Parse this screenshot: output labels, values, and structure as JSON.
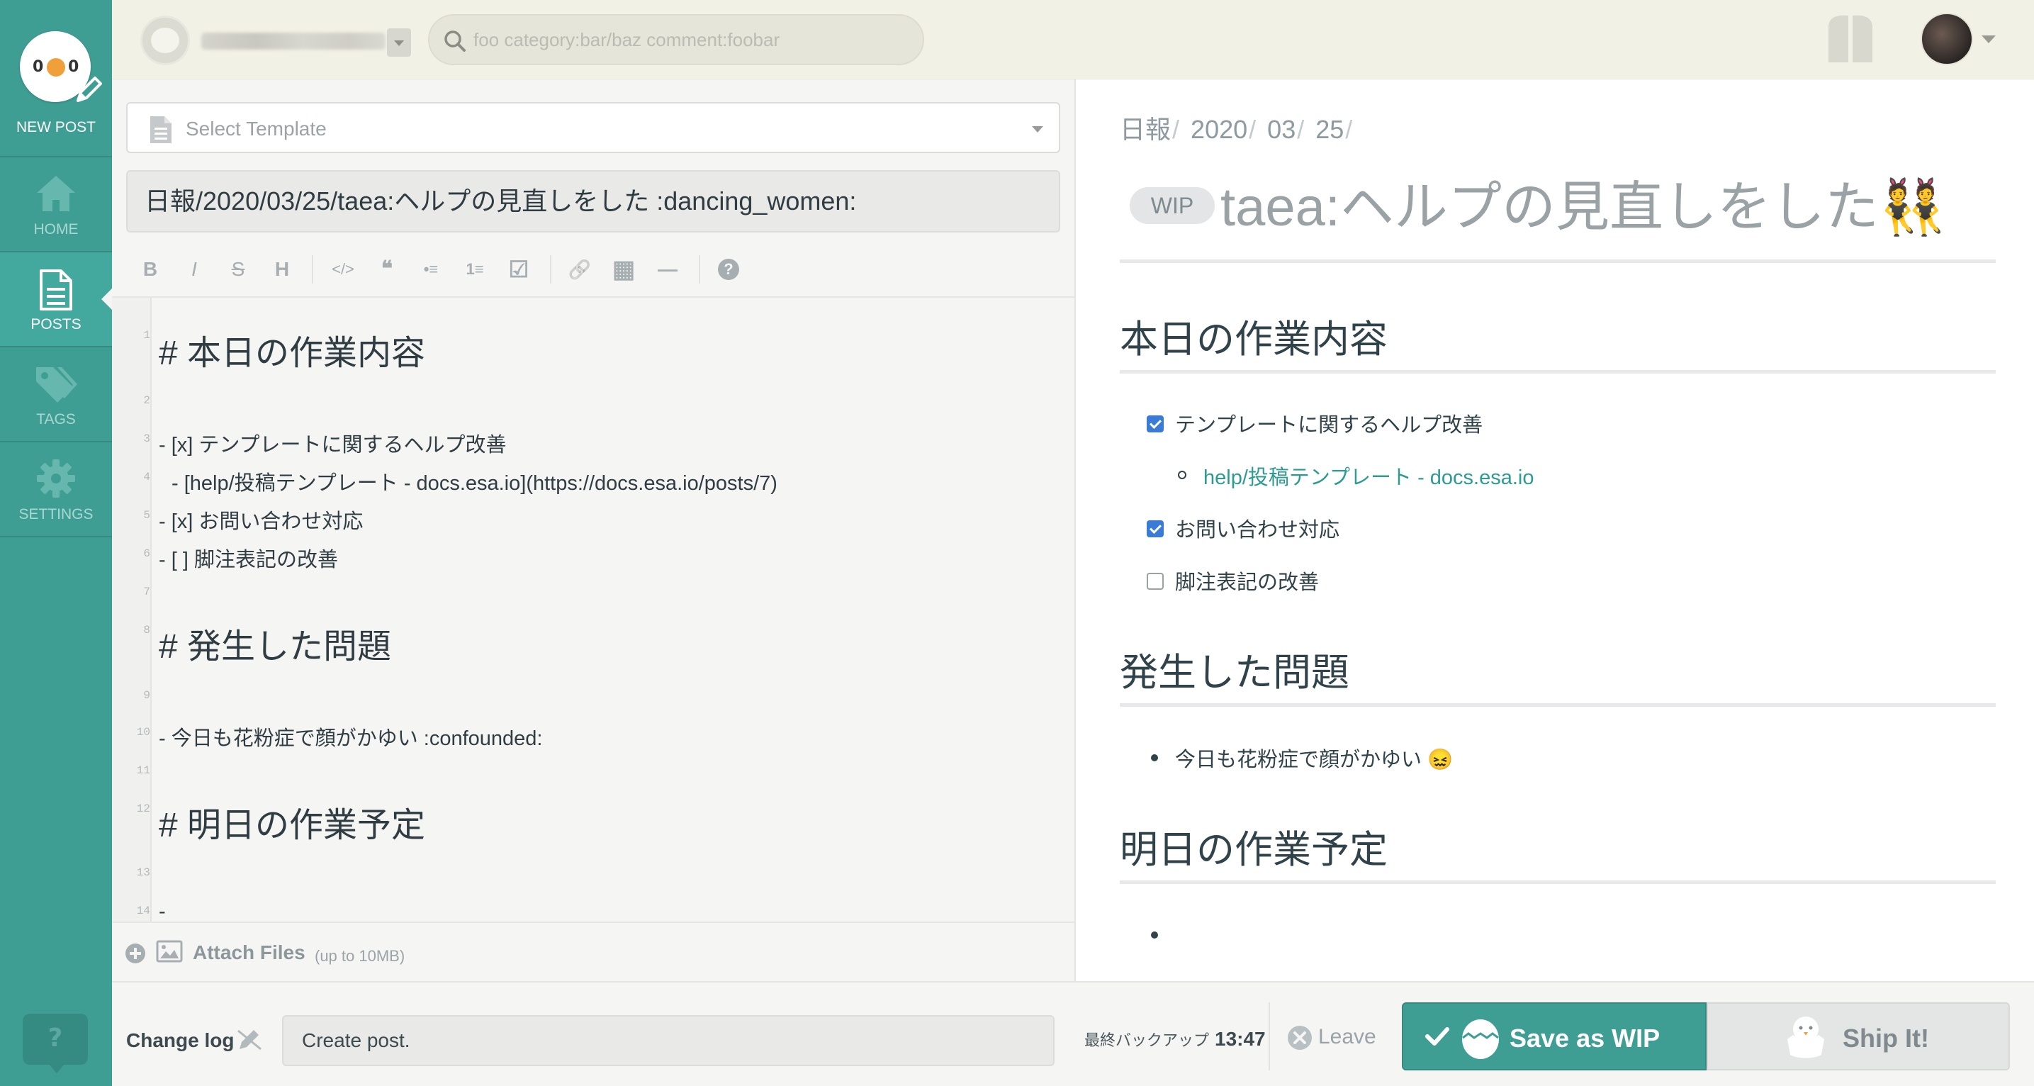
{
  "sidebar": {
    "new_post_label": "NEW POST",
    "items": [
      {
        "label": "HOME",
        "icon": "home-icon"
      },
      {
        "label": "POSTS",
        "icon": "document-icon",
        "active": true
      },
      {
        "label": "TAGS",
        "icon": "tags-icon"
      },
      {
        "label": "SETTINGS",
        "icon": "gear-icon"
      }
    ],
    "help_label": "?"
  },
  "header": {
    "search_placeholder": "foo category:bar/baz comment:foobar"
  },
  "editor": {
    "template_label": "Select Template",
    "title_value": "日報/2020/03/25/taea:ヘルプの見直しをした :dancing_women:",
    "toolbar": [
      "B",
      "I",
      "S",
      "H",
      "</>",
      "❝",
      "•≡",
      "1≡",
      "☑",
      "🔗",
      "▦",
      "—",
      "?"
    ],
    "lines": [
      {
        "no": "1",
        "text": "# 本日の作業内容"
      },
      {
        "no": "2",
        "text": ""
      },
      {
        "no": "3",
        "text": "- [x] テンプレートに関するヘルプ改善"
      },
      {
        "no": "4",
        "text": "  - [help/投稿テンプレート - docs.esa.io](https://docs.esa.io/posts/7)"
      },
      {
        "no": "5",
        "text": "- [x] お問い合わせ対応"
      },
      {
        "no": "6",
        "text": "- [ ] 脚注表記の改善"
      },
      {
        "no": "7",
        "text": ""
      },
      {
        "no": "8",
        "text": "# 発生した問題"
      },
      {
        "no": "9",
        "text": ""
      },
      {
        "no": "10",
        "text": "- 今日も花粉症で顔がかゆい :confounded:"
      },
      {
        "no": "11",
        "text": ""
      },
      {
        "no": "12",
        "text": "# 明日の作業予定"
      },
      {
        "no": "13",
        "text": ""
      },
      {
        "no": "14",
        "text": "-"
      }
    ],
    "attach_label": "Attach Files",
    "attach_limit": "(up to 10MB)"
  },
  "preview": {
    "breadcrumbs": [
      "日報",
      "2020",
      "03",
      "25"
    ],
    "wip_badge": "WIP",
    "title": "taea:ヘルプの見直しをした👯",
    "sections": [
      {
        "heading": "本日の作業内容"
      },
      {
        "heading": "発生した問題"
      },
      {
        "heading": "明日の作業予定"
      }
    ],
    "tasks": [
      {
        "text": "テンプレートに関するヘルプ改善",
        "checked": true
      },
      {
        "text": "お問い合わせ対応",
        "checked": true
      },
      {
        "text": "脚注表記の改善",
        "checked": false
      }
    ],
    "link_text": "help/投稿テンプレート - docs.esa.io",
    "problem": "今日も花粉症で顔がかゆい 😖"
  },
  "footer": {
    "changelog_label": "Change log",
    "changelog_value": "Create post.",
    "backup_label": "最終バックアップ",
    "backup_time": "13:47",
    "leave_label": "Leave",
    "save_wip_label": "Save as WIP",
    "ship_label": "Ship It!"
  },
  "colors": {
    "sidebar": "#3f9e94",
    "header": "#f2f1e6",
    "accent_link": "#2d9c90",
    "checkbox": "#3a7bd5"
  }
}
